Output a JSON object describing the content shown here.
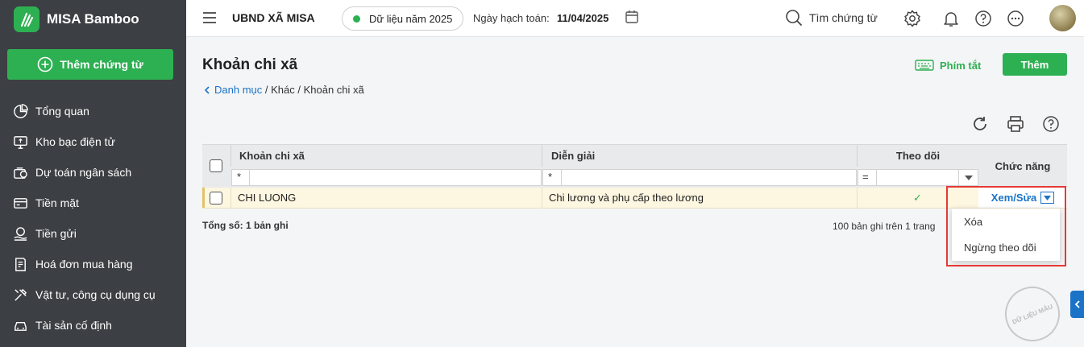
{
  "app": {
    "name": "MISA Bamboo"
  },
  "sidebar": {
    "add_label": "Thêm chứng từ",
    "items": [
      {
        "label": "Tổng quan",
        "icon": "pie-chart-icon"
      },
      {
        "label": "Kho bạc điện tử",
        "icon": "monitor-icon"
      },
      {
        "label": "Dự toán ngân sách",
        "icon": "budget-icon"
      },
      {
        "label": "Tiền mặt",
        "icon": "cash-icon"
      },
      {
        "label": "Tiền gửi",
        "icon": "coin-hand-icon"
      },
      {
        "label": "Hoá đơn mua hàng",
        "icon": "invoice-icon"
      },
      {
        "label": "Vật tư, công cụ dụng cụ",
        "icon": "tools-icon"
      },
      {
        "label": "Tài sản cố định",
        "icon": "car-icon"
      }
    ]
  },
  "header": {
    "org": "UBND XÃ MISA",
    "year": "Dữ liệu năm 2025",
    "acc_date_label": "Ngày hạch toán:",
    "acc_date": "11/04/2025",
    "search_label": "Tìm chứng từ"
  },
  "page": {
    "title": "Khoản chi xã",
    "breadcrumb": {
      "root": "Danh mục",
      "sep1": " / ",
      "mid": "Khác",
      "sep2": " / ",
      "current": "Khoản chi xã"
    },
    "shortcut_label": "Phím tắt",
    "add_label": "Thêm"
  },
  "table": {
    "columns": {
      "name": "Khoản chi xã",
      "desc": "Diễn giải",
      "track": "Theo dõi",
      "func": "Chức năng"
    },
    "filters": {
      "name": "*",
      "desc": "*",
      "track": "="
    },
    "rows": [
      {
        "name": "CHI LUONG",
        "desc": "Chi lương và phụ cấp theo lương",
        "tracked": "✓",
        "action": "Xem/Sửa"
      }
    ],
    "total": "Tổng số: 1 bản ghi",
    "paging": "100 bản ghi trên 1 trang"
  },
  "menu": {
    "items": [
      "Xóa",
      "Ngừng theo dõi"
    ]
  },
  "watermark": "DỮ LIỆU MẪU",
  "colors": {
    "brand": "#2db052",
    "sidebar": "#3c3f43",
    "link": "#1a73c7",
    "highlight": "#e53935",
    "row_selected": "#fdf6e0"
  }
}
